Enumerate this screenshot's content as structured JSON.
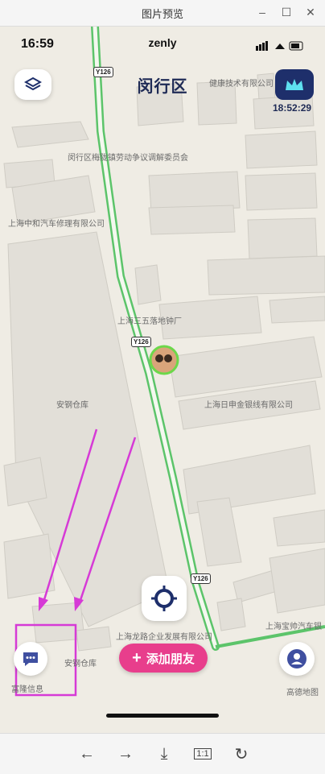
{
  "window": {
    "title": "图片预览",
    "controls": [
      "–",
      "☐",
      "✕"
    ]
  },
  "status_bar": {
    "time": "16:59",
    "app_name": "zenly"
  },
  "map": {
    "district": "闵行区",
    "clock": "18:52:29",
    "road_tags": [
      "Y126",
      "Y126",
      "Y126"
    ],
    "pois": [
      "闵行区梅陇镇劳动争议调解委员会",
      "上海中和汽车修理有限公司",
      "上海三五落地钟厂",
      "安钢仓库",
      "上海日申金银线有限公司",
      "上海龙路企业发展有限公司",
      "安钢仓库",
      "上海宝帅汽车银",
      "健康技术有限公司",
      "富隆信息",
      "高德地图"
    ]
  },
  "actions": {
    "add_friend": "添加朋友"
  },
  "toolbar": {
    "back": "←",
    "forward": "→",
    "download": "⤓",
    "actual_size": "1:1",
    "rotate": "↻"
  },
  "colors": {
    "accent_pink": "#e83e8c",
    "navy": "#1e2f6b",
    "road_green": "#5cc46a",
    "annotation": "#d63ad6"
  }
}
